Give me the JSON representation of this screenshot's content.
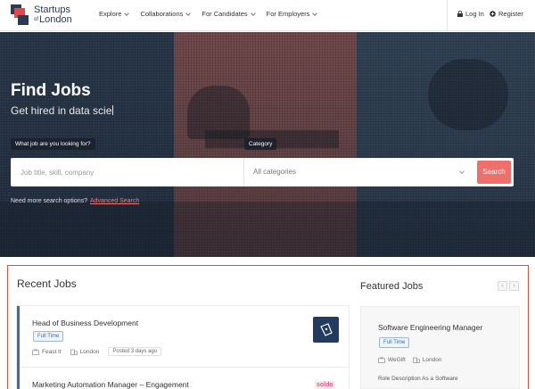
{
  "brand": {
    "line1": "Startups",
    "of": "of",
    "line2": "London"
  },
  "nav": {
    "menu": [
      {
        "label": "Explore"
      },
      {
        "label": "Collaborations"
      },
      {
        "label": "For Candidates"
      },
      {
        "label": "For Employers"
      }
    ],
    "login_label": "Log In",
    "register_label": "Register"
  },
  "hero": {
    "title": "Find Jobs",
    "subtitle": "Get hired in data scie",
    "keyword_label": "What job are you looking for?",
    "category_label": "Category",
    "keyword_placeholder": "Job title, skill, company",
    "category_value": "All categories",
    "search_button": "Search",
    "advanced_prompt": "Need more search options?",
    "advanced_link": "Advanced Search"
  },
  "recent": {
    "title": "Recent Jobs",
    "jobs": [
      {
        "title": "Head of Business Development",
        "type": "Full Time",
        "company": "Feast It",
        "location": "London",
        "posted": "Posted 3 days ago"
      },
      {
        "title": "Marketing Automation Manager – Engagement",
        "company_logo_text": "soldo"
      }
    ]
  },
  "featured": {
    "title": "Featured Jobs",
    "prev_label": "‹",
    "next_label": "›",
    "job": {
      "title": "Software Engineering Manager",
      "type": "Full Time",
      "company": "WeGift",
      "location": "London",
      "description": "Role Description As a Software"
    }
  },
  "colors": {
    "accent": "#ef6f6c",
    "frame": "#d2573f",
    "badge": "#3a6fa0",
    "brand": "#2b3a55"
  }
}
